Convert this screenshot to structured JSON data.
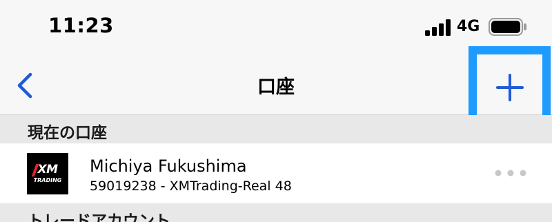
{
  "status_bar": {
    "time": "11:23",
    "network": "4G",
    "icons": [
      "signal-icon",
      "battery-icon"
    ]
  },
  "nav": {
    "title": "口座",
    "back_icon": "chevron-left-icon",
    "add_icon": "plus-icon",
    "accent_color": "#1f5bd6",
    "highlight_color": "#1e9bff"
  },
  "current_section": {
    "label": "現在の口座"
  },
  "account": {
    "logo_text": "XM",
    "logo_subtext": "TRADING",
    "name": "Michiya Fukushima",
    "detail": "59019238 - XMTrading-Real 48",
    "more_icon": "more-dots-icon"
  },
  "trade_section": {
    "label": "トレードアカウント"
  }
}
